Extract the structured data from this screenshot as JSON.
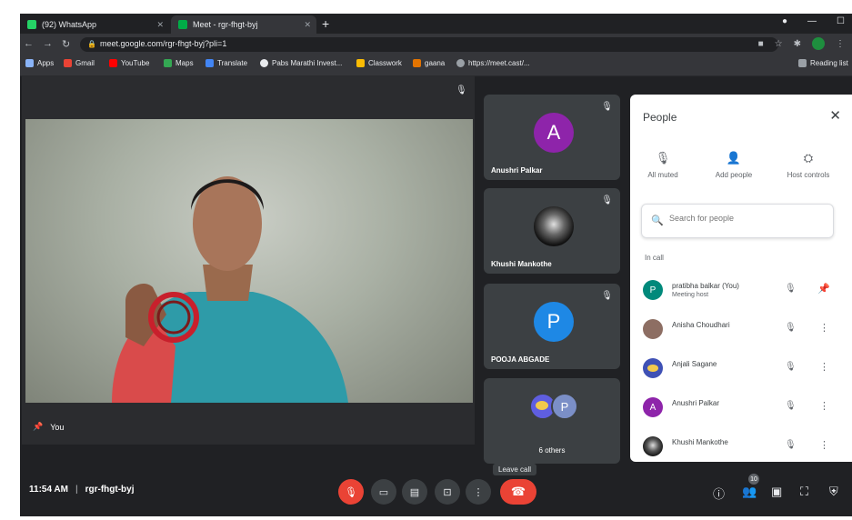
{
  "browser": {
    "tabs": [
      {
        "title": "(92) WhatsApp",
        "favicon_color": "#25d366"
      },
      {
        "title": "Meet - rgr-fhgt-byj",
        "favicon_color": "#00ac47"
      }
    ],
    "new_tab": "+",
    "url": "meet.google.com/rgr-fhgt-byj?pli=1",
    "bookmarks": [
      {
        "label": "Apps",
        "color": "#8ab4f8"
      },
      {
        "label": "Gmail",
        "color": "#ea4335"
      },
      {
        "label": "YouTube",
        "color": "#ff0000"
      },
      {
        "label": "Maps",
        "color": "#34a853"
      },
      {
        "label": "Translate",
        "color": "#4285f4"
      },
      {
        "label": "Pabs Marathi Invest...",
        "color": "#e8eaed"
      },
      {
        "label": "Classwork",
        "color": "#fbbc04"
      },
      {
        "label": "gaana",
        "color": "#e37400"
      },
      {
        "label": "https://meet.cast/...",
        "color": "#9aa0a6"
      },
      {
        "label": "Reading list",
        "color": "#9aa0a6"
      }
    ]
  },
  "main_tile": {
    "label": "You"
  },
  "tiles": [
    {
      "name": "Anushri Palkar",
      "initial": "A",
      "avatar_color": "#8e24aa"
    },
    {
      "name": "Khushi Mankothe",
      "initial": "",
      "avatar_color": "#1b1b1b"
    },
    {
      "name": "POOJA ABGADE",
      "initial": "P",
      "avatar_color": "#1e88e5"
    },
    {
      "name": "6 others",
      "initial": "P",
      "avatar_color": "#7b8fc7"
    }
  ],
  "people_panel": {
    "title": "People",
    "actions": [
      {
        "label": "All muted",
        "icon": "mic-off-icon"
      },
      {
        "label": "Add people",
        "icon": "person-add-icon"
      },
      {
        "label": "Host controls",
        "icon": "host-controls-icon"
      }
    ],
    "search_placeholder": "Search for people",
    "section_label": "In call",
    "participants": [
      {
        "name": "pratibha balkar (You)",
        "sub": "Meeting host",
        "initial": "P",
        "color": "#00897b"
      },
      {
        "name": "Anisha Choudhari",
        "sub": "",
        "initial": "",
        "color": "#8d6e63"
      },
      {
        "name": "Anjali Sagane",
        "sub": "",
        "initial": "",
        "color": "#3f51b5"
      },
      {
        "name": "Anushri Palkar",
        "sub": "",
        "initial": "A",
        "color": "#8e24aa"
      },
      {
        "name": "Khushi Mankothe",
        "sub": "",
        "initial": "",
        "color": "#1b1b1b"
      }
    ]
  },
  "bottom_bar": {
    "time": "11:54 AM",
    "separator": "|",
    "meeting_code": "rgr-fhgt-byj",
    "leave_tooltip": "Leave call",
    "people_count": "10"
  }
}
